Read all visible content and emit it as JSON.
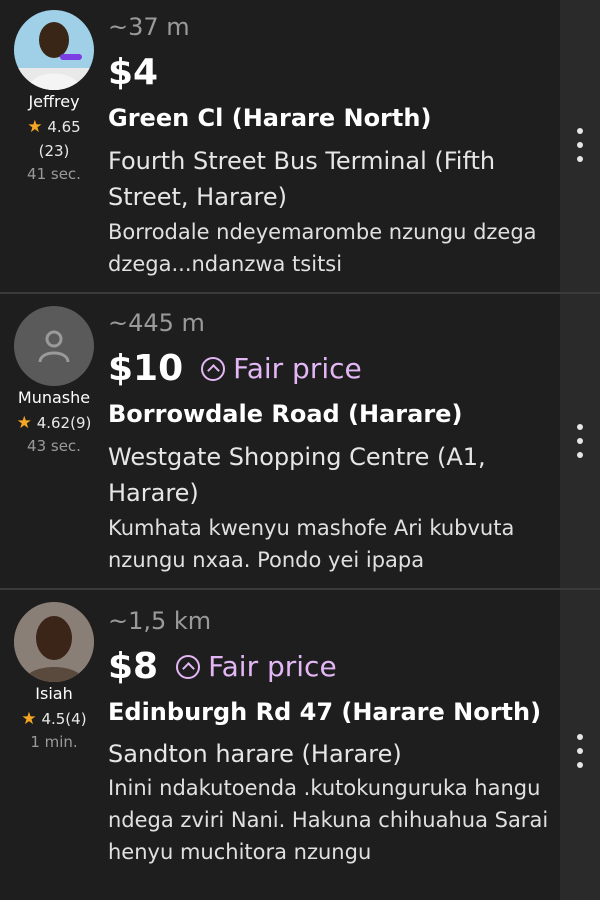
{
  "offers": [
    {
      "driver": "Jeffrey",
      "rating": "4.65",
      "reviews": "(23)",
      "time": "41 sec.",
      "distance": "~37 m",
      "price": "$4",
      "fair_price": "",
      "pickup": "Green Cl (Harare North)",
      "destination": "Fourth Street Bus Terminal (Fifth Street, Harare)",
      "comment": "Borrodale ndeyemarombe nzungu dzega dzega...ndanzwa tsitsi",
      "avatar": "photo"
    },
    {
      "driver": "Munashe",
      "rating": "4.62(9)",
      "reviews": "",
      "time": "43 sec.",
      "distance": "~445 m",
      "price": "$10",
      "fair_price": "Fair price",
      "pickup": "Borrowdale Road (Harare)",
      "destination": "Westgate Shopping Centre (A1, Harare)",
      "comment": "Kumhata kwenyu mashofe Ari kubvuta nzungu nxaa. Pondo yei ipapa",
      "avatar": "placeholder"
    },
    {
      "driver": "Isiah",
      "rating": "4.5(4)",
      "reviews": "",
      "time": "1 min.",
      "distance": "~1,5 km",
      "price": "$8",
      "fair_price": "Fair price",
      "pickup": "Edinburgh Rd 47 (Harare North)",
      "destination": "Sandton harare (Harare)",
      "comment": "Inini ndakutoenda .kutokunguruka hangu ndega zviri Nani. Hakuna chihuahua Sarai henyu muchitora nzungu",
      "avatar": "photo"
    }
  ],
  "colors": {
    "background": "#1e1e1e",
    "fair_price": "#e3b7f5",
    "star": "#f5a623",
    "muted": "#9a9a9a"
  },
  "icons": {
    "rating": "star-icon",
    "fair_price": "chevron-up-circle-icon",
    "menu": "more-vertical-icon",
    "avatar_placeholder": "person-icon"
  }
}
